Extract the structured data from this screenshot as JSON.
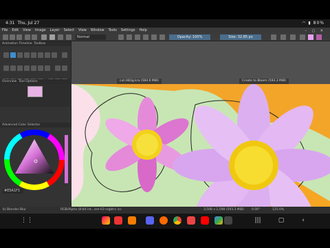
{
  "status": {
    "time": "4:31",
    "date": "Thu, Jul 27",
    "battery": "80%"
  },
  "menu": [
    "File",
    "Edit",
    "View",
    "Image",
    "Layer",
    "Select",
    "View",
    "Window",
    "Tools",
    "Settings",
    "Help"
  ],
  "toolbar": {
    "blend_mode": "Normal",
    "opacity": "Opacity: 100%",
    "size": "Size: 32.85 px"
  },
  "docker": {
    "toolbox_title": "Animation Timeline",
    "toolbox_title2": "Toolbox",
    "overview_title": "Overview",
    "overview_tab2": "Tool Options",
    "color_title": "Advanced Color Selector",
    "hex": "#E5A1F1"
  },
  "tabs": [
    {
      "label": "cut.HiDig.kra (584.6 MiB)"
    },
    {
      "label": "Create to Bloom (593.3 MiB)"
    }
  ],
  "kstatus": {
    "brush": "b) Blender Blur",
    "color": "RGB/Alpha (8-bit int...ere-V2-srgbtrc.icc",
    "dims": "3,508 x 2,598 (593.3 MiB)",
    "rotation": "0.00°",
    "zoom": "125.0%"
  },
  "colors": {
    "accent": "#3d8fd0",
    "petal": "#e1a2ef",
    "center": "#f3d11a",
    "orange": "#f4a317"
  }
}
